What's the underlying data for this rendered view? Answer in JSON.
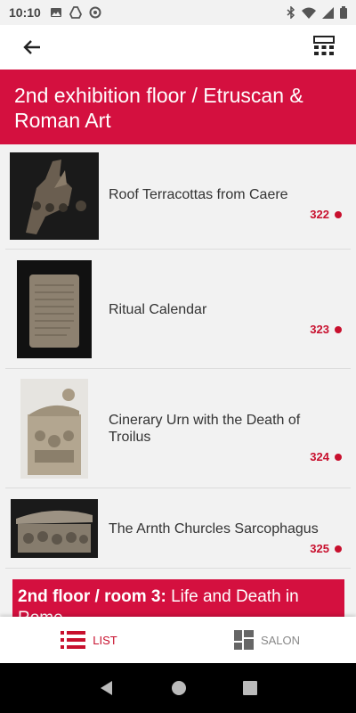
{
  "status": {
    "time": "10:10"
  },
  "header": {
    "title": "2nd exhibition floor / Etruscan & Roman Art"
  },
  "items": [
    {
      "title": "Roof Terracottas from Caere",
      "number": "322"
    },
    {
      "title": "Ritual Calendar",
      "number": "323"
    },
    {
      "title": "Cinerary Urn with the Death of Troilus",
      "number": "324"
    },
    {
      "title": "The Arnth Churcles Sarcophagus",
      "number": "325"
    }
  ],
  "section": {
    "prefix": "2nd floor / room 3:",
    "title": "Life and Death in Rome"
  },
  "tabs": {
    "list": "LIST",
    "salon": "SALON"
  },
  "colors": {
    "accent": "#d4103f",
    "background": "#f2f2f2"
  }
}
